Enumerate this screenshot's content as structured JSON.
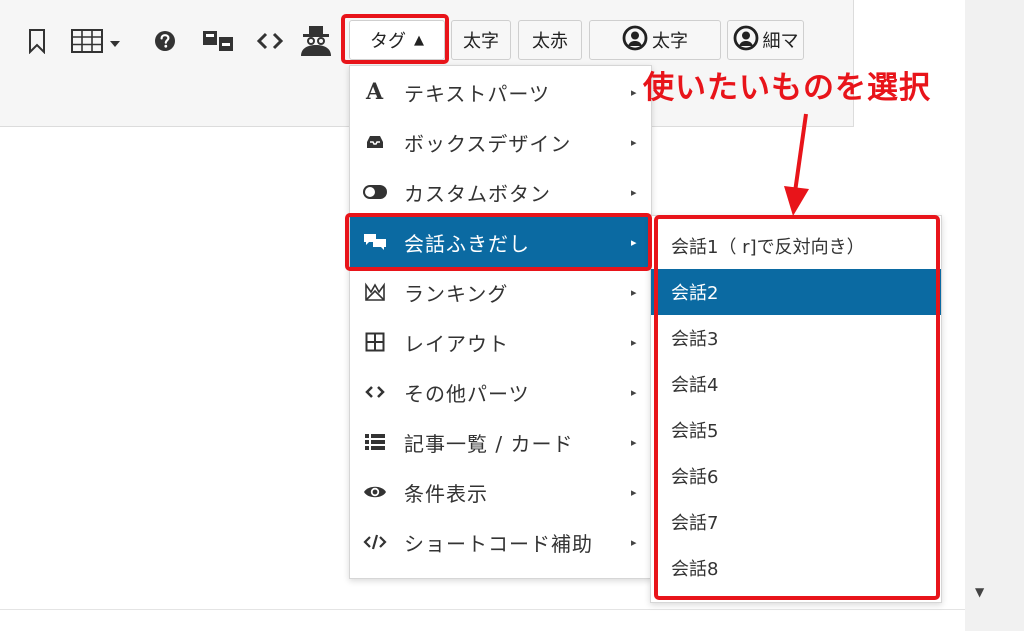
{
  "toolbar": {
    "icons": [
      "bookmark-icon",
      "table-icon",
      "question-icon",
      "transfer-icon",
      "code-icon",
      "spy-icon"
    ],
    "tag_label": "タグ",
    "tag_caret": "▲",
    "bold_label": "太字",
    "bold_red_label": "太赤",
    "avatar_bold_label": "太字",
    "avatar_thin_label": "細マ"
  },
  "menu": {
    "items": [
      {
        "label": "テキストパーツ",
        "icon": "letter-a-icon",
        "arrow": "▸"
      },
      {
        "label": "ボックスデザイン",
        "icon": "inbox-icon",
        "arrow": "▸"
      },
      {
        "label": "カスタムボタン",
        "icon": "toggle-icon",
        "arrow": "▸"
      },
      {
        "label": "会話ふきだし",
        "icon": "comments-icon",
        "arrow": "▸"
      },
      {
        "label": "ランキング",
        "icon": "crown-icon",
        "arrow": "▸"
      },
      {
        "label": "レイアウト",
        "icon": "grid-icon",
        "arrow": "▸"
      },
      {
        "label": "その他パーツ",
        "icon": "code-icon",
        "arrow": "▸"
      },
      {
        "label": "記事一覧 / カード",
        "icon": "list-icon",
        "arrow": "▸"
      },
      {
        "label": "条件表示",
        "icon": "eye-icon",
        "arrow": "▸"
      },
      {
        "label": "ショートコード補助",
        "icon": "code-slash-icon",
        "arrow": "▸"
      }
    ],
    "active_index": 3
  },
  "submenu": {
    "items": [
      "会話1（ r]で反対向き）",
      "会話2",
      "会話3",
      "会話4",
      "会話5",
      "会話6",
      "会話7",
      "会話8"
    ],
    "active_index": 1
  },
  "annotation": {
    "text": "使いたいものを選択"
  },
  "colors": {
    "accent": "#0b6aa2",
    "highlight": "#e8141a"
  },
  "scroll_arrow": "▼"
}
